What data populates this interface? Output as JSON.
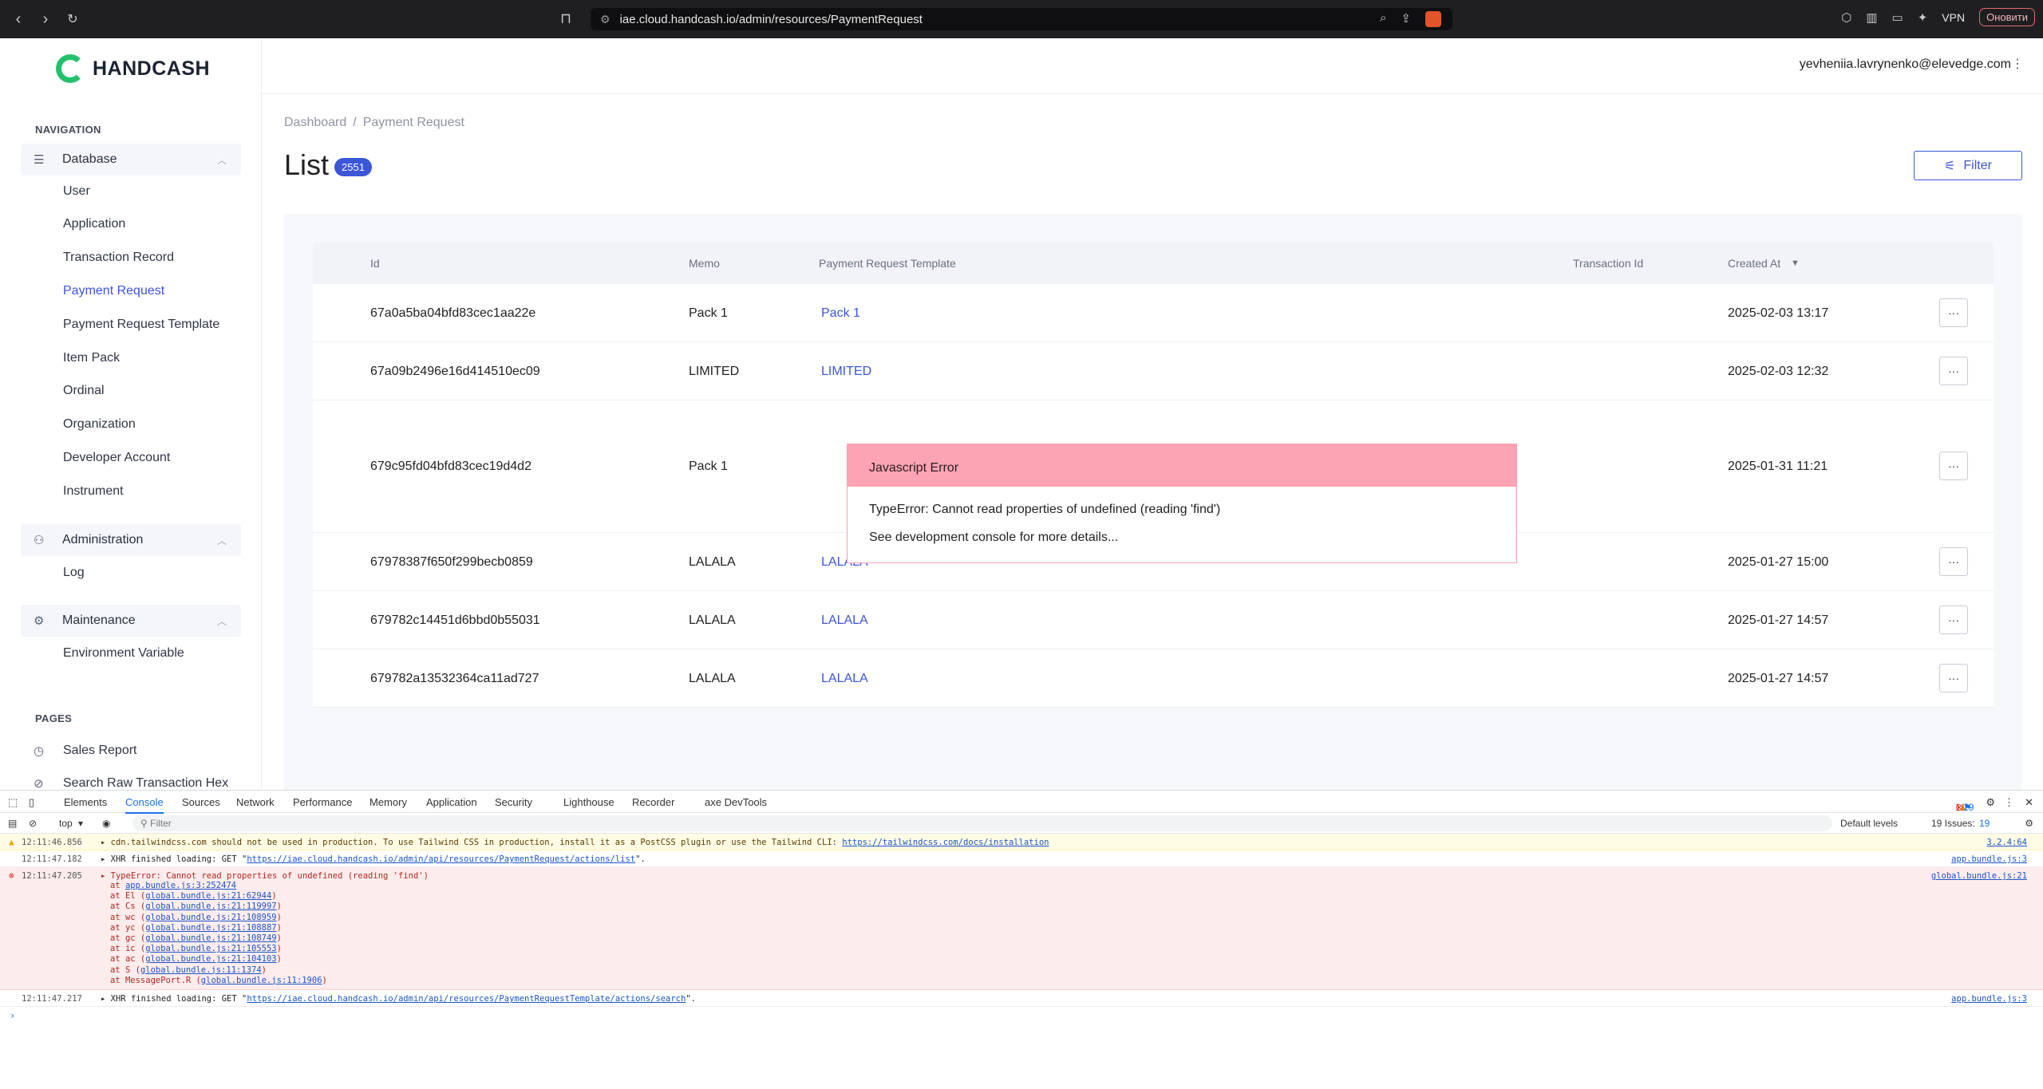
{
  "browser": {
    "url": "iae.cloud.handcash.io/admin/resources/PaymentRequest",
    "vpn_label": "VPN",
    "update_label": "Оновити"
  },
  "sidebar": {
    "logo_text": "HANDCASH",
    "navigation_heading": "NAVIGATION",
    "sections": [
      {
        "label": "Database",
        "items": [
          "User",
          "Application",
          "Transaction Record",
          "Payment Request",
          "Payment Request Template",
          "Item Pack",
          "Ordinal",
          "Organization",
          "Developer Account",
          "Instrument"
        ]
      },
      {
        "label": "Administration",
        "items": [
          "Log"
        ]
      },
      {
        "label": "Maintenance",
        "items": [
          "Environment Variable"
        ]
      }
    ],
    "active_item": "Payment Request",
    "pages_heading": "PAGES",
    "pages": [
      "Sales Report",
      "Search Raw Transaction Hex"
    ]
  },
  "header": {
    "user_email": "yevheniia.lavrynenko@elevedge.com"
  },
  "main": {
    "breadcrumb": [
      "Dashboard",
      "Payment Request"
    ],
    "title": "List",
    "count": "2551",
    "filter_label": "Filter",
    "columns": [
      "Id",
      "Memo",
      "Payment Request Template",
      "Transaction Id",
      "Created At"
    ],
    "rows": [
      {
        "id": "67a0a5ba04bfd83cec1aa22e",
        "memo": "Pack 1",
        "template": "Pack 1",
        "transaction_id": "",
        "created_at": "2025-02-03 13:17"
      },
      {
        "id": "67a09b2496e16d414510ec09",
        "memo": "LIMITED",
        "template": "LIMITED",
        "transaction_id": "",
        "created_at": "2025-02-03 12:32"
      },
      {
        "id": "679c95fd04bfd83cec19d4d2",
        "memo": "Pack 1",
        "template": "",
        "transaction_id": "",
        "created_at": "2025-01-31 11:21"
      },
      {
        "id": "67978387f650f299becb0859",
        "memo": "LALALA",
        "template": "LALALA",
        "transaction_id": "",
        "created_at": "2025-01-27 15:00"
      },
      {
        "id": "679782c14451d6bbd0b55031",
        "memo": "LALALA",
        "template": "LALALA",
        "transaction_id": "",
        "created_at": "2025-01-27 14:57"
      },
      {
        "id": "679782a13532364ca11ad727",
        "memo": "LALALA",
        "template": "LALALA",
        "transaction_id": "",
        "created_at": "2025-01-27 14:57"
      }
    ],
    "actions_label": "···",
    "error": {
      "title": "Javascript Error",
      "message": "TypeError: Cannot read properties of undefined (reading 'find')",
      "hint": "See development console for more details..."
    }
  },
  "devtools": {
    "tabs": [
      "Elements",
      "Console",
      "Sources",
      "Network",
      "Performance",
      "Memory",
      "Application",
      "Security",
      "Lighthouse",
      "Recorder",
      "axe DevTools"
    ],
    "active_tab": "Console",
    "error_count": "1",
    "warning_count": "1",
    "issues_count": "19",
    "context": "top",
    "filter_placeholder": "Filter",
    "levels": "Default levels",
    "issues_label": "19 Issues:",
    "issues_badge": "19",
    "messages": {
      "warn": {
        "ts": "12:11:46.856",
        "text": "cdn.tailwindcss.com should not be used in production. To use Tailwind CSS in production, install it as a PostCSS plugin or use the Tailwind CLI: ",
        "link": "https://tailwindcss.com/docs/installation",
        "src": "3.2.4:64"
      },
      "xhr1": {
        "ts": "12:11:47.182",
        "prefix": "XHR finished loading: GET \"",
        "link": "https://iae.cloud.handcash.io/admin/api/resources/PaymentRequest/actions/list",
        "suffix": "\".",
        "src": "app.bundle.js:3"
      },
      "error": {
        "ts": "12:11:47.205",
        "text": "TypeError: Cannot read properties of undefined (reading 'find')",
        "src": "global.bundle.js:21"
      },
      "stack": [
        {
          "pre": "at ",
          "link": "app.bundle.js:3:252474",
          "post": ""
        },
        {
          "pre": "at El (",
          "link": "global.bundle.js:21:62944",
          "post": ")"
        },
        {
          "pre": "at Cs (",
          "link": "global.bundle.js:21:119997",
          "post": ")"
        },
        {
          "pre": "at wc (",
          "link": "global.bundle.js:21:108959",
          "post": ")"
        },
        {
          "pre": "at yc (",
          "link": "global.bundle.js:21:108887",
          "post": ")"
        },
        {
          "pre": "at gc (",
          "link": "global.bundle.js:21:108749",
          "post": ")"
        },
        {
          "pre": "at ic (",
          "link": "global.bundle.js:21:105553",
          "post": ")"
        },
        {
          "pre": "at ac (",
          "link": "global.bundle.js:21:104103",
          "post": ")"
        },
        {
          "pre": "at S (",
          "link": "global.bundle.js:11:1374",
          "post": ")"
        },
        {
          "pre": "at MessagePort.R (",
          "link": "global.bundle.js:11:1906",
          "post": ")"
        }
      ],
      "xhr2": {
        "ts": "12:11:47.217",
        "prefix": "XHR finished loading: GET \"",
        "link": "https://iae.cloud.handcash.io/admin/api/resources/PaymentRequestTemplate/actions/search",
        "suffix": "\".",
        "src": "app.bundle.js:3"
      }
    }
  },
  "colors": {
    "accent": "#3b56d9",
    "brand_green": "#23c16b",
    "error_header": "#fda4b4"
  },
  "icons": [
    "back-icon",
    "forward-icon",
    "reload-icon",
    "bookmark-icon",
    "database-icon",
    "admin-icon",
    "gear-icon",
    "clock-icon",
    "search-icon",
    "filter-icon",
    "chevron-up-icon",
    "more-icon"
  ]
}
